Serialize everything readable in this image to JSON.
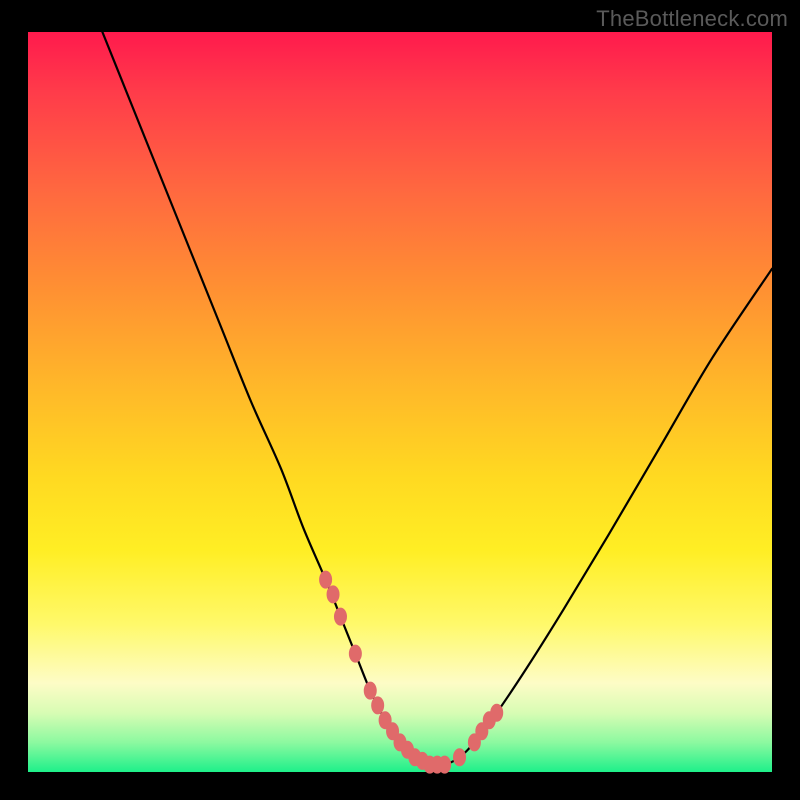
{
  "watermark": "TheBottleneck.com",
  "chart_data": {
    "type": "line",
    "title": "",
    "xlabel": "",
    "ylabel": "",
    "xlim": [
      0,
      100
    ],
    "ylim": [
      0,
      100
    ],
    "series": [
      {
        "name": "bottleneck-curve",
        "x": [
          10,
          14,
          18,
          22,
          26,
          30,
          34,
          37,
          40,
          42,
          44,
          46,
          48,
          50,
          52,
          54,
          56,
          58,
          60,
          63,
          67,
          72,
          78,
          85,
          92,
          100
        ],
        "y": [
          100,
          90,
          80,
          70,
          60,
          50,
          41,
          33,
          26,
          21,
          16,
          11,
          7,
          4,
          2,
          1,
          1,
          2,
          4,
          8,
          14,
          22,
          32,
          44,
          56,
          68
        ]
      }
    ],
    "markers": {
      "name": "highlight-dots",
      "color": "#e06a6a",
      "x": [
        40,
        41,
        42,
        44,
        46,
        47,
        48,
        49,
        50,
        51,
        52,
        53,
        54,
        55,
        56,
        58,
        60,
        61,
        62,
        63
      ],
      "y": [
        26,
        24,
        21,
        16,
        11,
        9,
        7,
        5.5,
        4,
        3,
        2,
        1.5,
        1,
        1,
        1,
        2,
        4,
        5.5,
        7,
        8
      ]
    },
    "gradient_stops": [
      {
        "pos": 0.0,
        "color": "#ff1a4d"
      },
      {
        "pos": 0.22,
        "color": "#ff6a3f"
      },
      {
        "pos": 0.48,
        "color": "#ffb829"
      },
      {
        "pos": 0.7,
        "color": "#ffee24"
      },
      {
        "pos": 0.88,
        "color": "#fdfcc6"
      },
      {
        "pos": 1.0,
        "color": "#1ef08a"
      }
    ]
  }
}
